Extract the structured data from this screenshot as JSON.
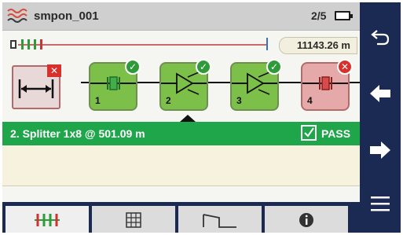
{
  "header": {
    "title": "smpon_001",
    "page_indicator": "2/5",
    "logo_icon": "wave-logo-icon",
    "battery_icon": "battery-icon"
  },
  "overview": {
    "distance": "11143.26 m"
  },
  "events": [
    {
      "number": "1",
      "type": "connector",
      "status": "pass",
      "icon": "connector-icon"
    },
    {
      "number": "2",
      "type": "splitter",
      "status": "pass",
      "icon": "splitter-icon"
    },
    {
      "number": "3",
      "type": "splitter",
      "status": "pass",
      "icon": "splitter-icon"
    },
    {
      "number": "4",
      "type": "connector",
      "status": "fail",
      "icon": "connector-icon"
    }
  ],
  "origin": {
    "status": "fail",
    "icon": "span-length-icon"
  },
  "status_bar": {
    "label": "2. Splitter 1x8 @ 501.09 m",
    "verdict": "PASS",
    "color": "#1fa54a"
  },
  "tabs": [
    {
      "name": "link-view-tab",
      "icon": "link-view-icon",
      "active": true
    },
    {
      "name": "table-tab",
      "icon": "table-icon",
      "active": false
    },
    {
      "name": "trace-tab",
      "icon": "trace-icon",
      "active": false
    },
    {
      "name": "info-tab",
      "icon": "info-icon",
      "active": false
    }
  ],
  "nav": [
    "back-icon",
    "previous-arrow-icon",
    "next-arrow-icon",
    "menu-icon"
  ],
  "colors": {
    "nav_bg": "#1b2a52",
    "pass_green": "#7cc04a",
    "fail_red": "#d8302a"
  }
}
